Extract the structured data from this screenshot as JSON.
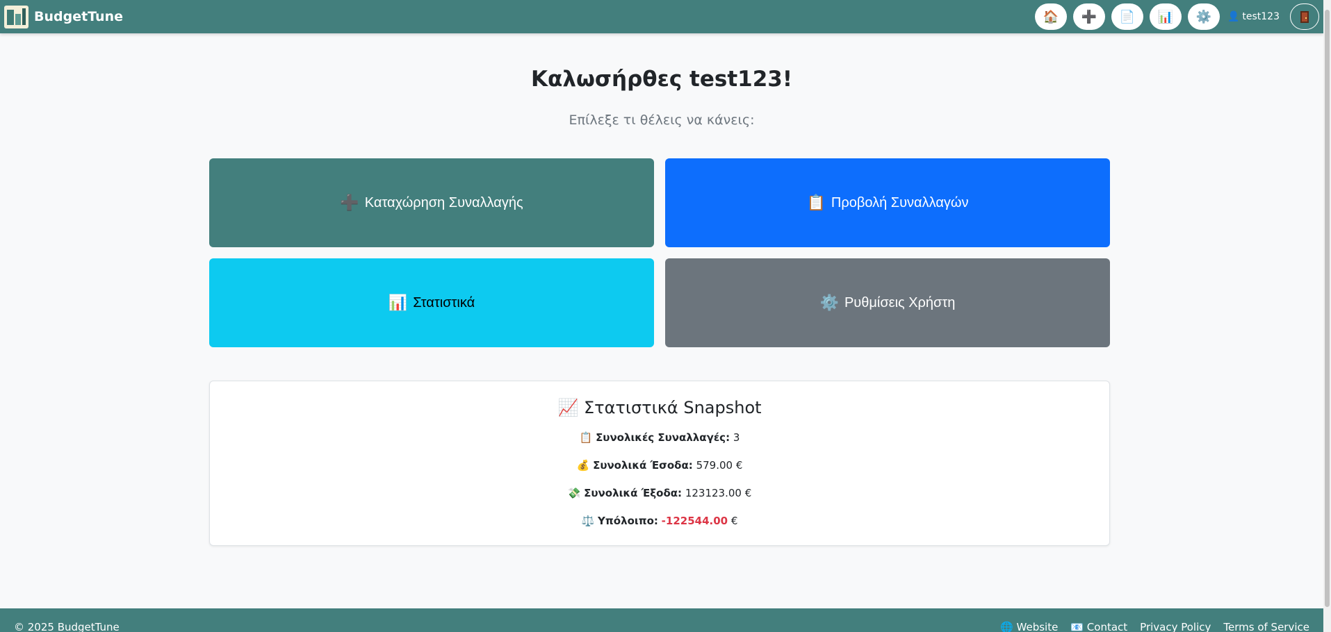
{
  "navbar": {
    "brand": "BudgetTune",
    "buttons": [
      {
        "name": "home",
        "icon": "🏠"
      },
      {
        "name": "add",
        "icon": "➕"
      },
      {
        "name": "transactions",
        "icon": "📄"
      },
      {
        "name": "stats",
        "icon": "📊"
      },
      {
        "name": "settings",
        "icon": "⚙️"
      }
    ],
    "user_icon": "👤",
    "username": "test123"
  },
  "main": {
    "welcome": "Καλωσήρθες test123!",
    "subtitle": "Επίλεξε τι θέλεις να κάνεις:",
    "actions": [
      {
        "icon": "➕",
        "label": "Καταχώρηση Συναλλαγής"
      },
      {
        "icon": "📋",
        "label": "Προβολή Συναλλαγών"
      },
      {
        "icon": "📊",
        "label": "Στατιστικά"
      },
      {
        "icon": "⚙️",
        "label": "Ρυθμίσεις Χρήστη"
      }
    ]
  },
  "snapshot": {
    "icon": "📈",
    "title": "Στατιστικά Snapshot",
    "rows": [
      {
        "icon": "📋",
        "label": "Συνολικές Συναλλαγές:",
        "value": "3",
        "unit": ""
      },
      {
        "icon": "💰",
        "label": "Συνολικά Έσοδα:",
        "value": "579.00",
        "unit": "€"
      },
      {
        "icon": "💸",
        "label": "Συνολικά Έξοδα:",
        "value": "123123.00",
        "unit": "€"
      },
      {
        "icon": "⚖️",
        "label": "Υπόλοιπο:",
        "value": "-122544.00",
        "unit": "€"
      }
    ]
  },
  "footer": {
    "copyright": "© 2025 BudgetTune",
    "links": [
      {
        "icon": "🌐",
        "label": "Website"
      },
      {
        "icon": "📧",
        "label": "Contact"
      },
      {
        "icon": "",
        "label": "Privacy Policy"
      },
      {
        "icon": "",
        "label": "Terms of Service"
      }
    ]
  },
  "colors": {
    "navbar": "#437f7d",
    "primary": "#0d6efd",
    "info": "#0dcaf0",
    "secondary": "#6c757d",
    "negative": "#dc3545"
  }
}
